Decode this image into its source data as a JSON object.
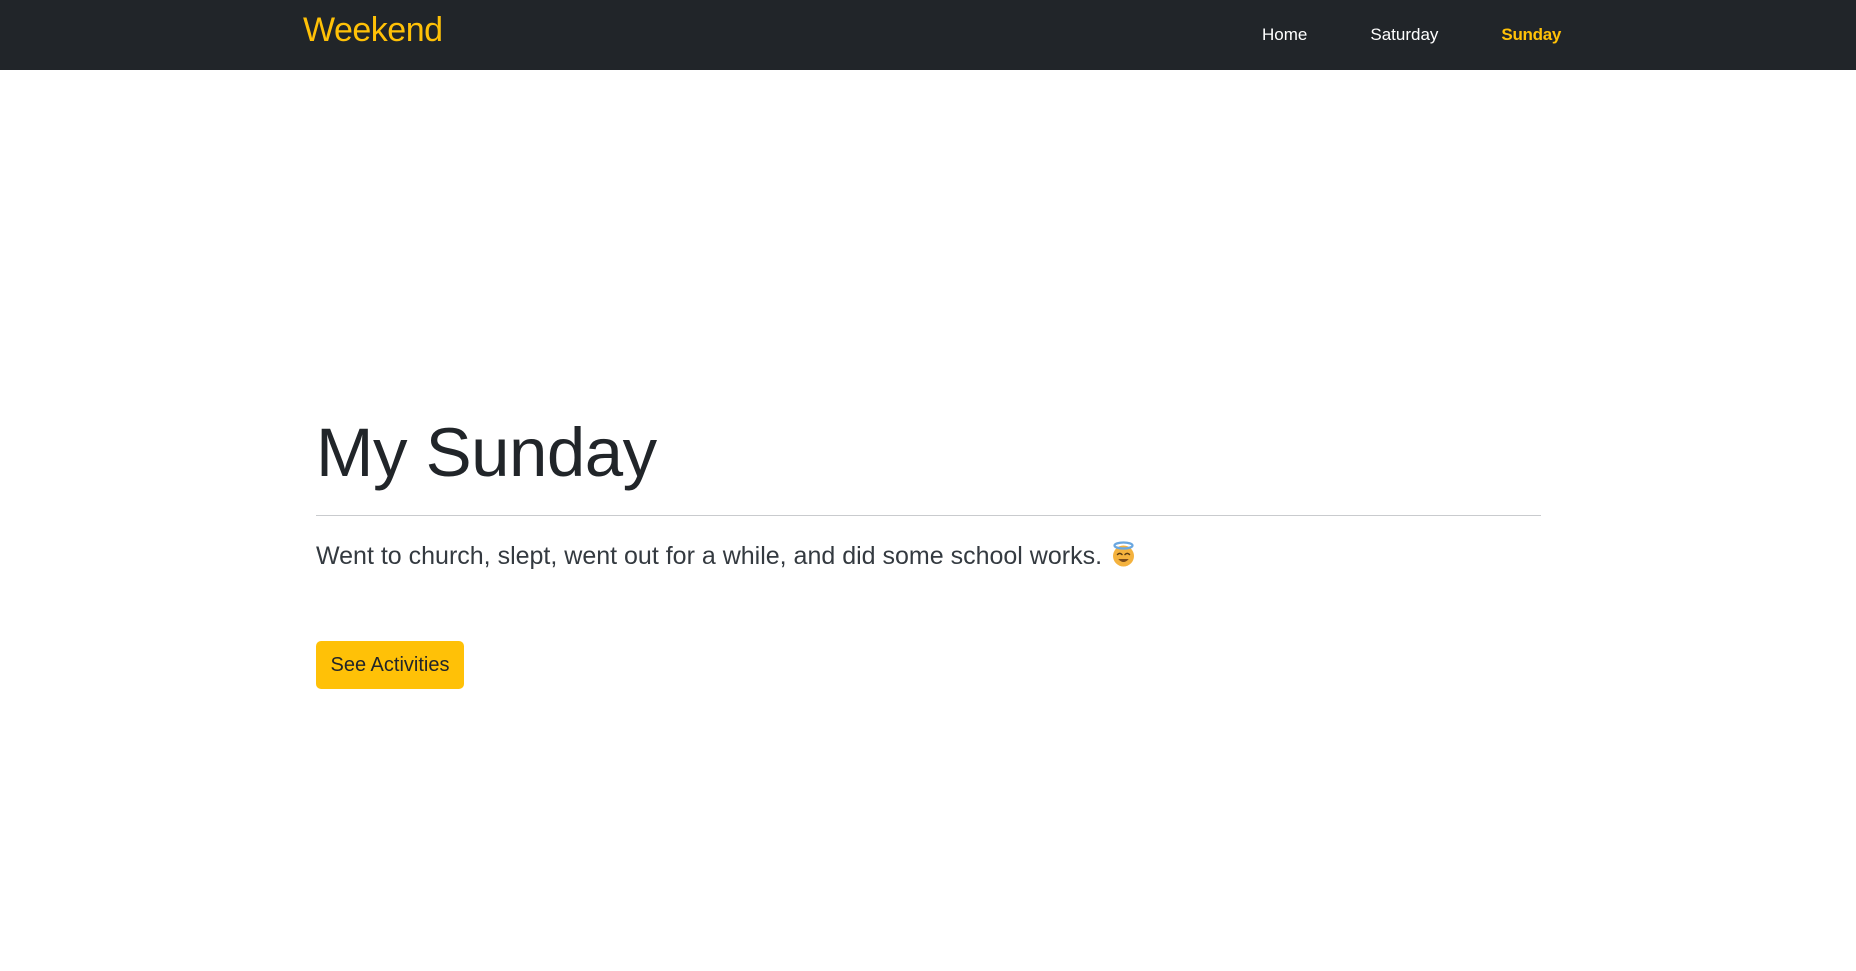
{
  "navbar": {
    "brand": "Weekend",
    "links": [
      {
        "label": "Home",
        "active": false
      },
      {
        "label": "Saturday",
        "active": false
      },
      {
        "label": "Sunday",
        "active": true
      }
    ]
  },
  "hero": {
    "title": "My Sunday",
    "text": "Went to church, slept, went out for a while, and did some school works.",
    "emoji_icon": "smiling-face-with-halo-icon",
    "button_label": "See Activities"
  },
  "colors": {
    "navbar_background": "#212529",
    "accent": "#ffc107",
    "text": "#212529",
    "link": "#ffffff"
  }
}
